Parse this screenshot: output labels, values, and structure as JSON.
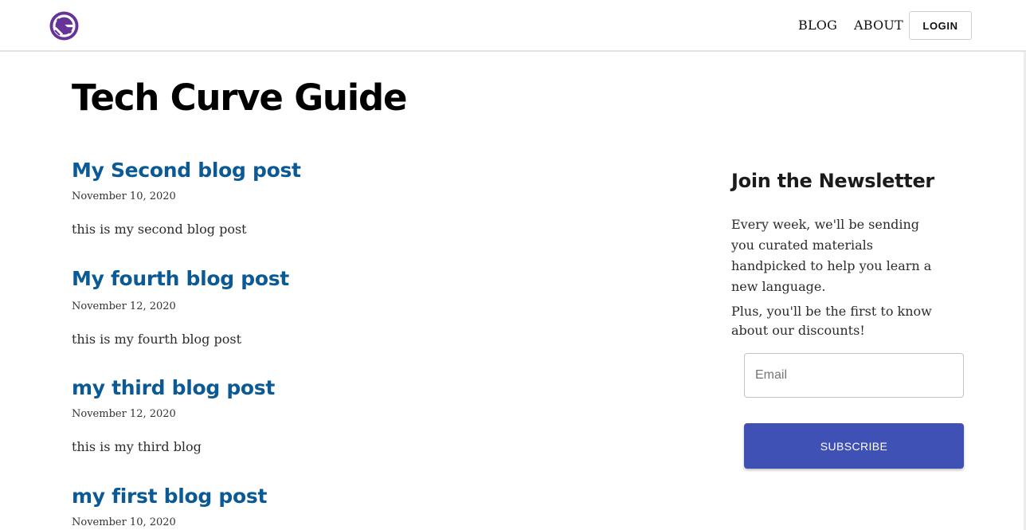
{
  "header": {
    "logo_icon": "gatsby-logo-icon",
    "nav": [
      {
        "label": "BLOG"
      },
      {
        "label": "ABOUT"
      }
    ],
    "login_label": "LOGIN"
  },
  "site_title": "Tech Curve Guide",
  "posts": [
    {
      "title": "My Second blog post",
      "date": "November 10, 2020",
      "excerpt": "this is my second blog post"
    },
    {
      "title": "My fourth blog post",
      "date": "November 12, 2020",
      "excerpt": "this is my fourth blog post"
    },
    {
      "title": "my third blog post",
      "date": "November 12, 2020",
      "excerpt": "this is my third blog"
    },
    {
      "title": "my first blog post",
      "date": "November 10, 2020",
      "excerpt": ""
    }
  ],
  "newsletter": {
    "title": "Join the Newsletter",
    "body": "Every week, we'll be sending you curated materials handpicked to help you learn a new language.",
    "plus": "Plus, you'll be the first to know about our discounts!",
    "email_placeholder": "Email",
    "email_value": "",
    "subscribe_label": "SUBSCRIBE"
  },
  "colors": {
    "brand_purple": "#663399",
    "link_blue": "#0b5a96",
    "button_indigo": "#3f51b5"
  }
}
